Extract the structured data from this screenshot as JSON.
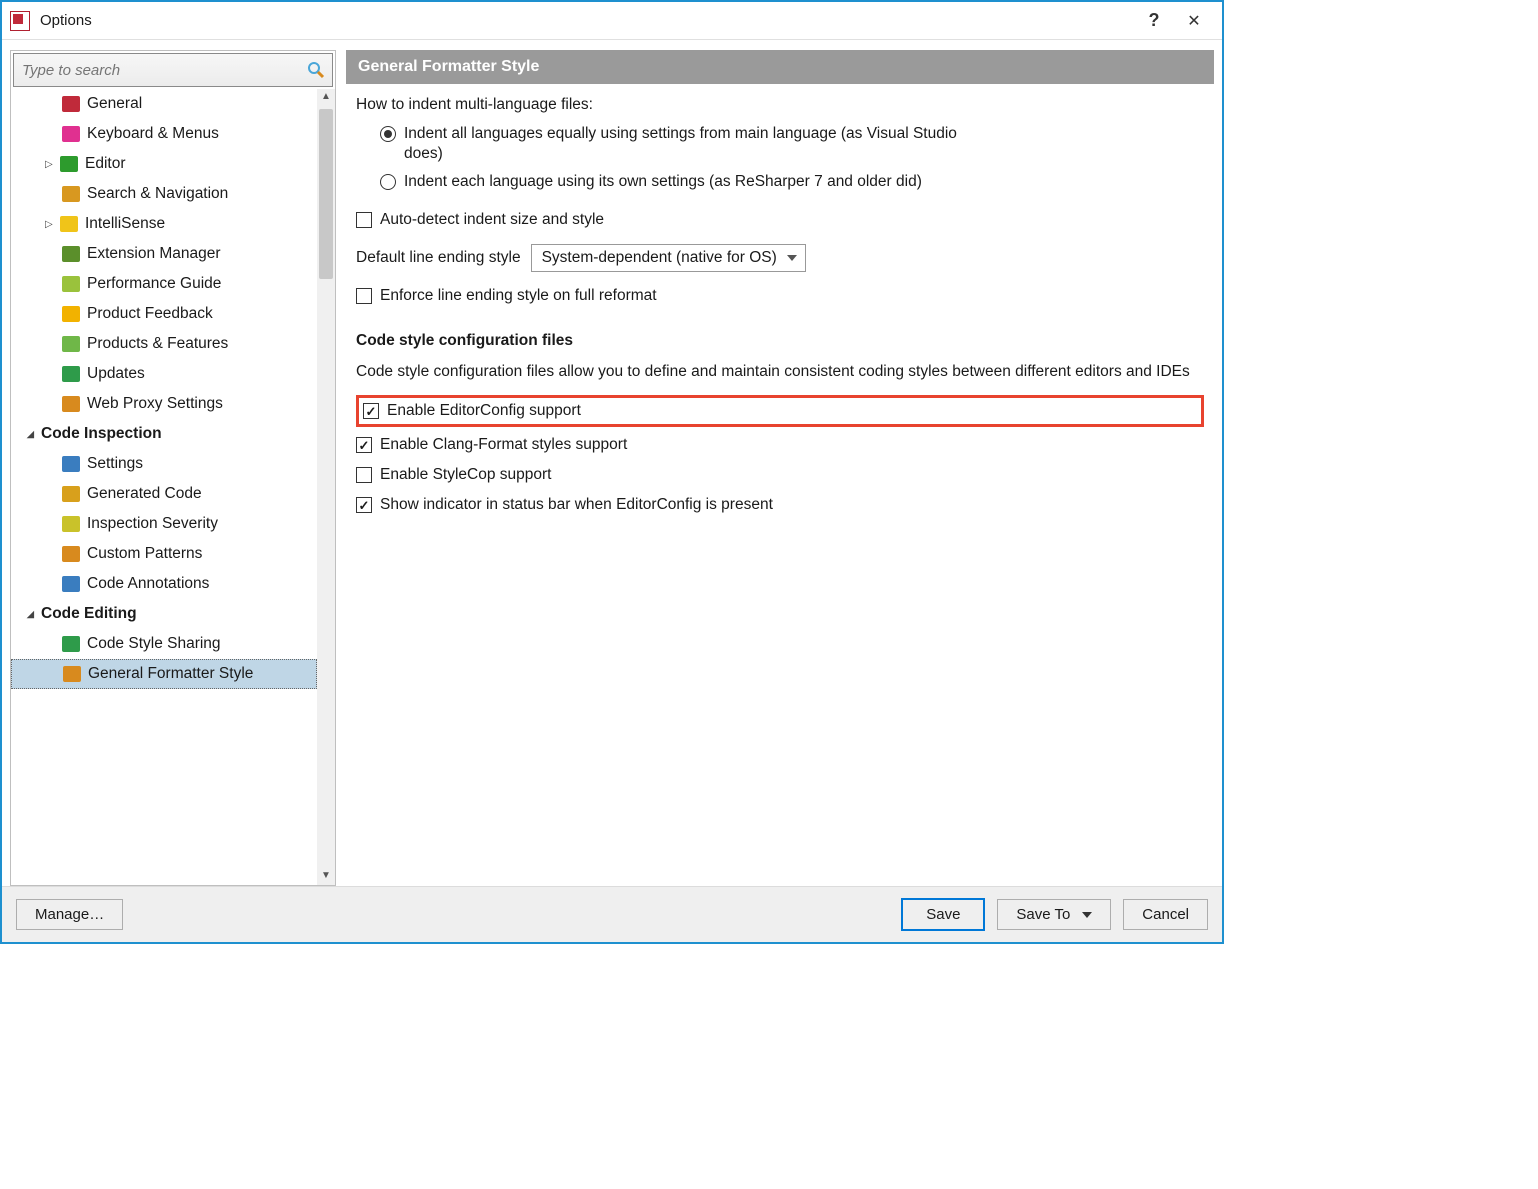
{
  "window": {
    "title": "Options"
  },
  "search": {
    "placeholder": "Type to search"
  },
  "tree": {
    "items": [
      {
        "label": "General",
        "type": "child",
        "icon": "#c02a3a"
      },
      {
        "label": "Keyboard & Menus",
        "type": "child",
        "icon": "#e03090"
      },
      {
        "label": "Editor",
        "type": "childx",
        "icon": "#2d9b2d",
        "expander": "▷"
      },
      {
        "label": "Search & Navigation",
        "type": "child",
        "icon": "#d89820"
      },
      {
        "label": "IntelliSense",
        "type": "childx",
        "icon": "#f0c419",
        "expander": "▷"
      },
      {
        "label": "Extension Manager",
        "type": "child",
        "icon": "#5b8f2b"
      },
      {
        "label": "Performance Guide",
        "type": "child",
        "icon": "#9ac23c"
      },
      {
        "label": "Product Feedback",
        "type": "child",
        "icon": "#f2b200"
      },
      {
        "label": "Products & Features",
        "type": "child",
        "icon": "#6fb748"
      },
      {
        "label": "Updates",
        "type": "child",
        "icon": "#2e9b4a"
      },
      {
        "label": "Web Proxy Settings",
        "type": "child",
        "icon": "#d88a1e"
      }
    ],
    "section1": "Code Inspection",
    "inspection": [
      {
        "label": "Settings",
        "icon": "#3a7dbf"
      },
      {
        "label": "Generated Code",
        "icon": "#d8a01c"
      },
      {
        "label": "Inspection Severity",
        "icon": "#c9c22a"
      },
      {
        "label": "Custom Patterns",
        "icon": "#d88a1e"
      },
      {
        "label": "Code Annotations",
        "icon": "#3a7dbf"
      }
    ],
    "section2": "Code Editing",
    "editing": [
      {
        "label": "Code Style Sharing",
        "icon": "#2e9b4a"
      },
      {
        "label": "General Formatter Style",
        "icon": "#d88a1e",
        "selected": true
      }
    ]
  },
  "panel": {
    "header": "General Formatter Style",
    "indent_label": "How to indent multi-language files:",
    "radio1": "Indent all languages equally using settings from main language (as Visual Studio does)",
    "radio2": "Indent each language using its own settings (as ReSharper 7 and older did)",
    "auto_detect": "Auto-detect indent size and style",
    "line_ending_label": "Default line ending style",
    "line_ending_value": "System-dependent (native for OS)",
    "enforce": "Enforce line ending style on full reformat",
    "config_header": "Code style configuration files",
    "config_desc": "Code style configuration files allow you to define and maintain consistent coding styles between different editors and IDEs",
    "enable_editorconfig": "Enable EditorConfig support",
    "enable_clang": "Enable Clang-Format styles support",
    "enable_stylecop": "Enable StyleCop support",
    "show_indicator": "Show indicator in status bar when EditorConfig is present"
  },
  "footer": {
    "manage": "Manage…",
    "save": "Save",
    "save_to": "Save To",
    "cancel": "Cancel"
  }
}
